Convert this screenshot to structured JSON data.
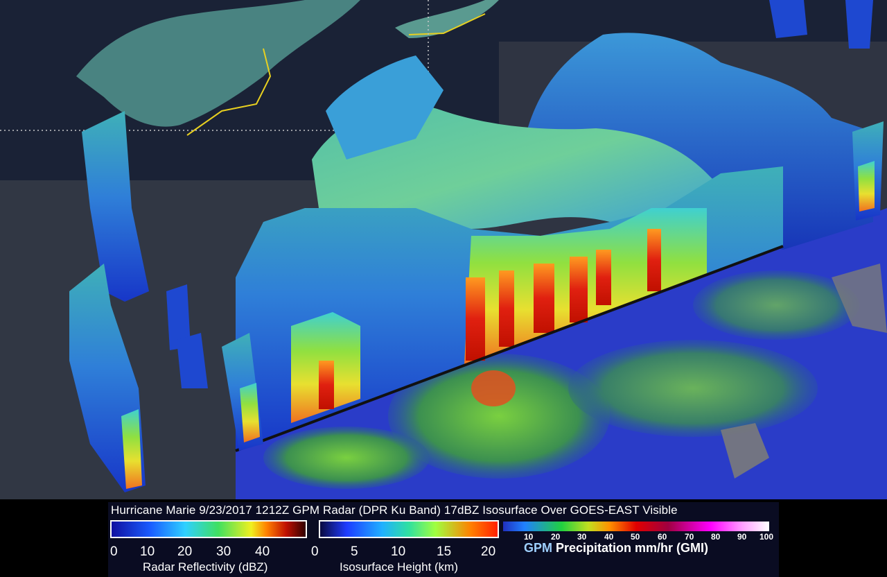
{
  "caption": {
    "title": "Hurricane Marie 9/23/2017 1212Z GPM Radar (DPR Ku Band) 17dBZ Isosurface Over GOES-EAST Visible"
  },
  "legend_reflectivity": {
    "label": "Radar Reflectivity (dBZ)",
    "ticks": [
      "0",
      "10",
      "20",
      "30",
      "40"
    ],
    "colors": [
      "#1010a0",
      "#1a5cff",
      "#2fd0ff",
      "#40e060",
      "#f0f020",
      "#ff8000",
      "#c01000",
      "#300000"
    ]
  },
  "legend_isosurface": {
    "label": "Isosurface Height (km)",
    "ticks": [
      "0",
      "5",
      "10",
      "15",
      "20"
    ],
    "colors": [
      "#0a0a40",
      "#1e3cff",
      "#20b0ff",
      "#30e0a0",
      "#a0ff40",
      "#ff8000",
      "#ff2000"
    ]
  },
  "legend_precipitation": {
    "label_prefix": "GPM",
    "label_rest": " Precipitation mm/hr (GMI)",
    "ticks": [
      "10",
      "20",
      "30",
      "40",
      "50",
      "60",
      "70",
      "80",
      "90",
      "100"
    ],
    "colors": [
      "#2030c0",
      "#2080ff",
      "#20d040",
      "#c0e020",
      "#ff9000",
      "#e00000",
      "#a00040",
      "#ff00ff",
      "#ffa0ff",
      "#ffffff"
    ]
  }
}
